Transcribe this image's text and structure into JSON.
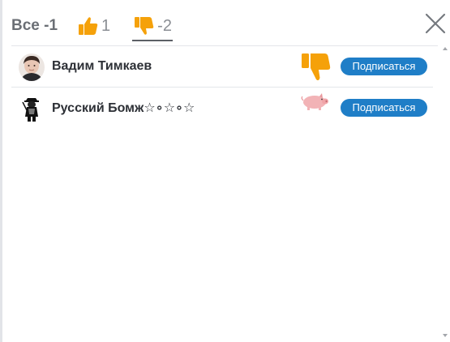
{
  "tabs": {
    "all_label": "Все -1",
    "likes_count": "1",
    "dislikes_count": "-2"
  },
  "users": [
    {
      "name": "Вадим Тимкаев",
      "reaction": "thumbs-down-icon",
      "button": "Подписаться"
    },
    {
      "name": "Русский Бомж☆∘☆∘☆",
      "reaction": "pig-icon",
      "button": "Подписаться"
    }
  ],
  "colors": {
    "accent_orange": "#f5a10a",
    "button_blue": "#1f7ec7",
    "text_dark": "#2d3036",
    "text_muted": "#6b6f75"
  }
}
